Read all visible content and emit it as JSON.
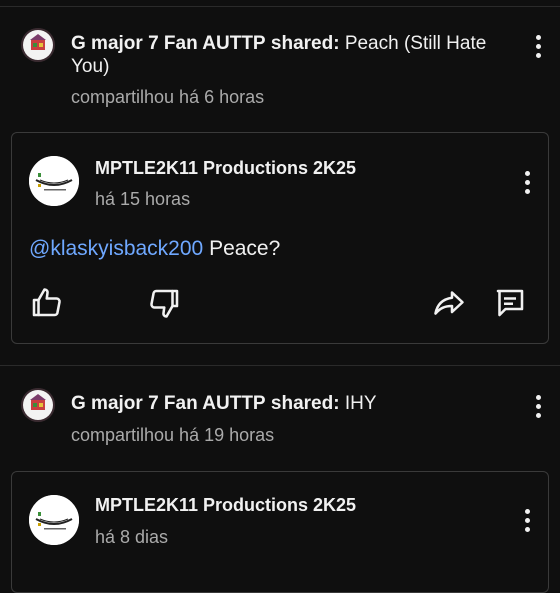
{
  "posts": [
    {
      "sharer_name": "G major 7 Fan AUTTP",
      "shared_label": "shared:",
      "shared_title": "Peach (Still Hate You)",
      "shared_meta": "compartilhou há 6 horas",
      "card": {
        "author": "MPTLE2K11 Productions 2K25",
        "time": "há 15 horas",
        "mention": "@klaskyisback200",
        "comment": " Peace?"
      }
    },
    {
      "sharer_name": "G major 7 Fan AUTTP",
      "shared_label": "shared:",
      "shared_title": "IHY",
      "shared_meta": "compartilhou há 19 horas",
      "card": {
        "author": "MPTLE2K11 Productions 2K25",
        "time": "há 8 dias"
      }
    }
  ],
  "icons": {
    "like": "thumbs-up-icon",
    "dislike": "thumbs-down-icon",
    "share": "share-icon",
    "reply": "comment-icon",
    "menu": "more-vert-icon"
  },
  "colors": {
    "background": "#0f0f0f",
    "text": "#f1f1f1",
    "secondary_text": "#aaaaaa",
    "mention": "#6fa8ff",
    "card_border": "#3a3a3a"
  }
}
